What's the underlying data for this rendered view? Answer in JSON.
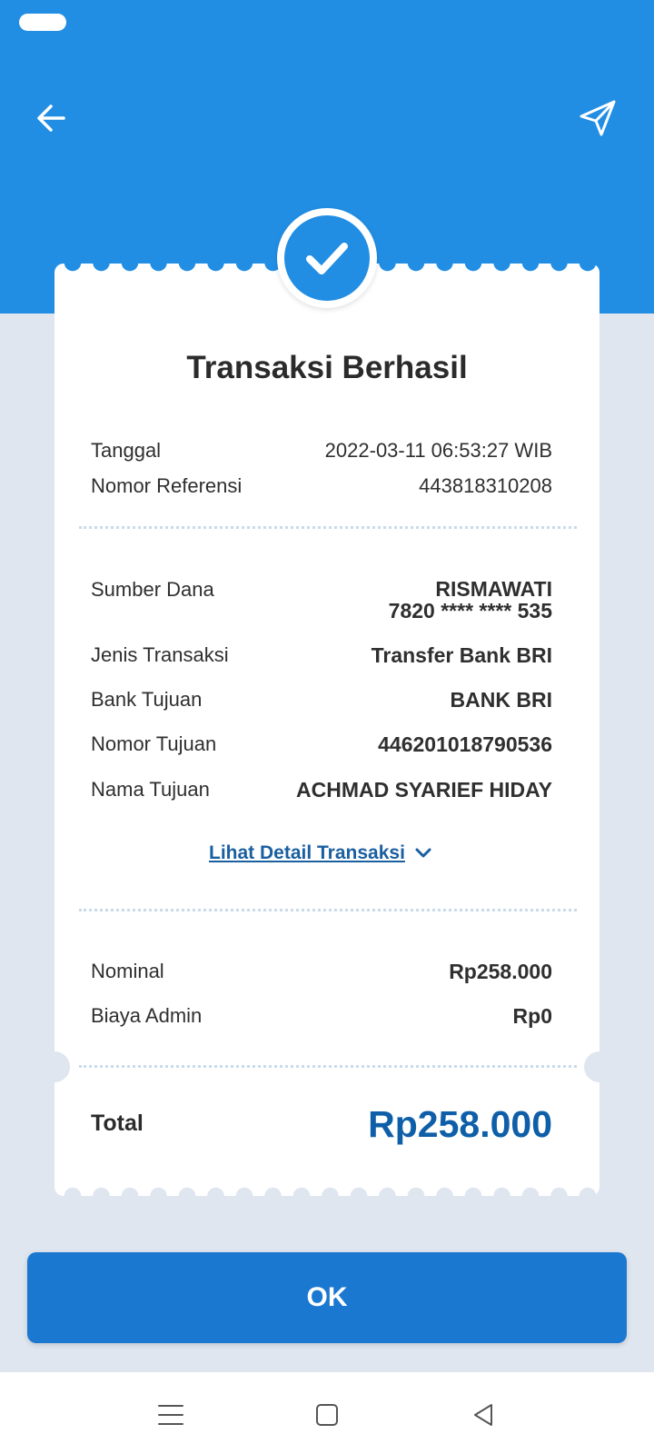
{
  "colors": {
    "primary": "#218ee4",
    "accent": "#0f5fa8",
    "button": "#1a78d0",
    "background": "#dfe6ef"
  },
  "header": {
    "back_icon": "arrow-left-icon",
    "share_icon": "send-icon"
  },
  "status_icon": "checkmark-icon",
  "title": "Transaksi Berhasil",
  "meta": [
    {
      "label": "Tanggal",
      "value": "2022-03-11 06:53:27 WIB"
    },
    {
      "label": "Nomor Referensi",
      "value": "443818310208"
    }
  ],
  "details": {
    "sumber_dana": {
      "label": "Sumber Dana",
      "name": "RISMAWATI",
      "account": "7820 **** **** 535"
    },
    "jenis_transaksi": {
      "label": "Jenis Transaksi",
      "value": "Transfer Bank BRI"
    },
    "bank_tujuan": {
      "label": "Bank Tujuan",
      "value": "BANK BRI"
    },
    "nomor_tujuan": {
      "label": "Nomor Tujuan",
      "value": "446201018790536"
    },
    "nama_tujuan": {
      "label": "Nama Tujuan",
      "value": "ACHMAD SYARIEF HIDAY"
    }
  },
  "detail_link": "Lihat Detail Transaksi",
  "amounts": [
    {
      "label": "Nominal",
      "value": "Rp258.000"
    },
    {
      "label": "Biaya Admin",
      "value": "Rp0"
    }
  ],
  "total": {
    "label": "Total",
    "value": "Rp258.000"
  },
  "ok_button": "OK",
  "navbar": {
    "menu_icon": "menu-icon",
    "home_icon": "home-square-icon",
    "back_icon": "back-triangle-icon"
  }
}
